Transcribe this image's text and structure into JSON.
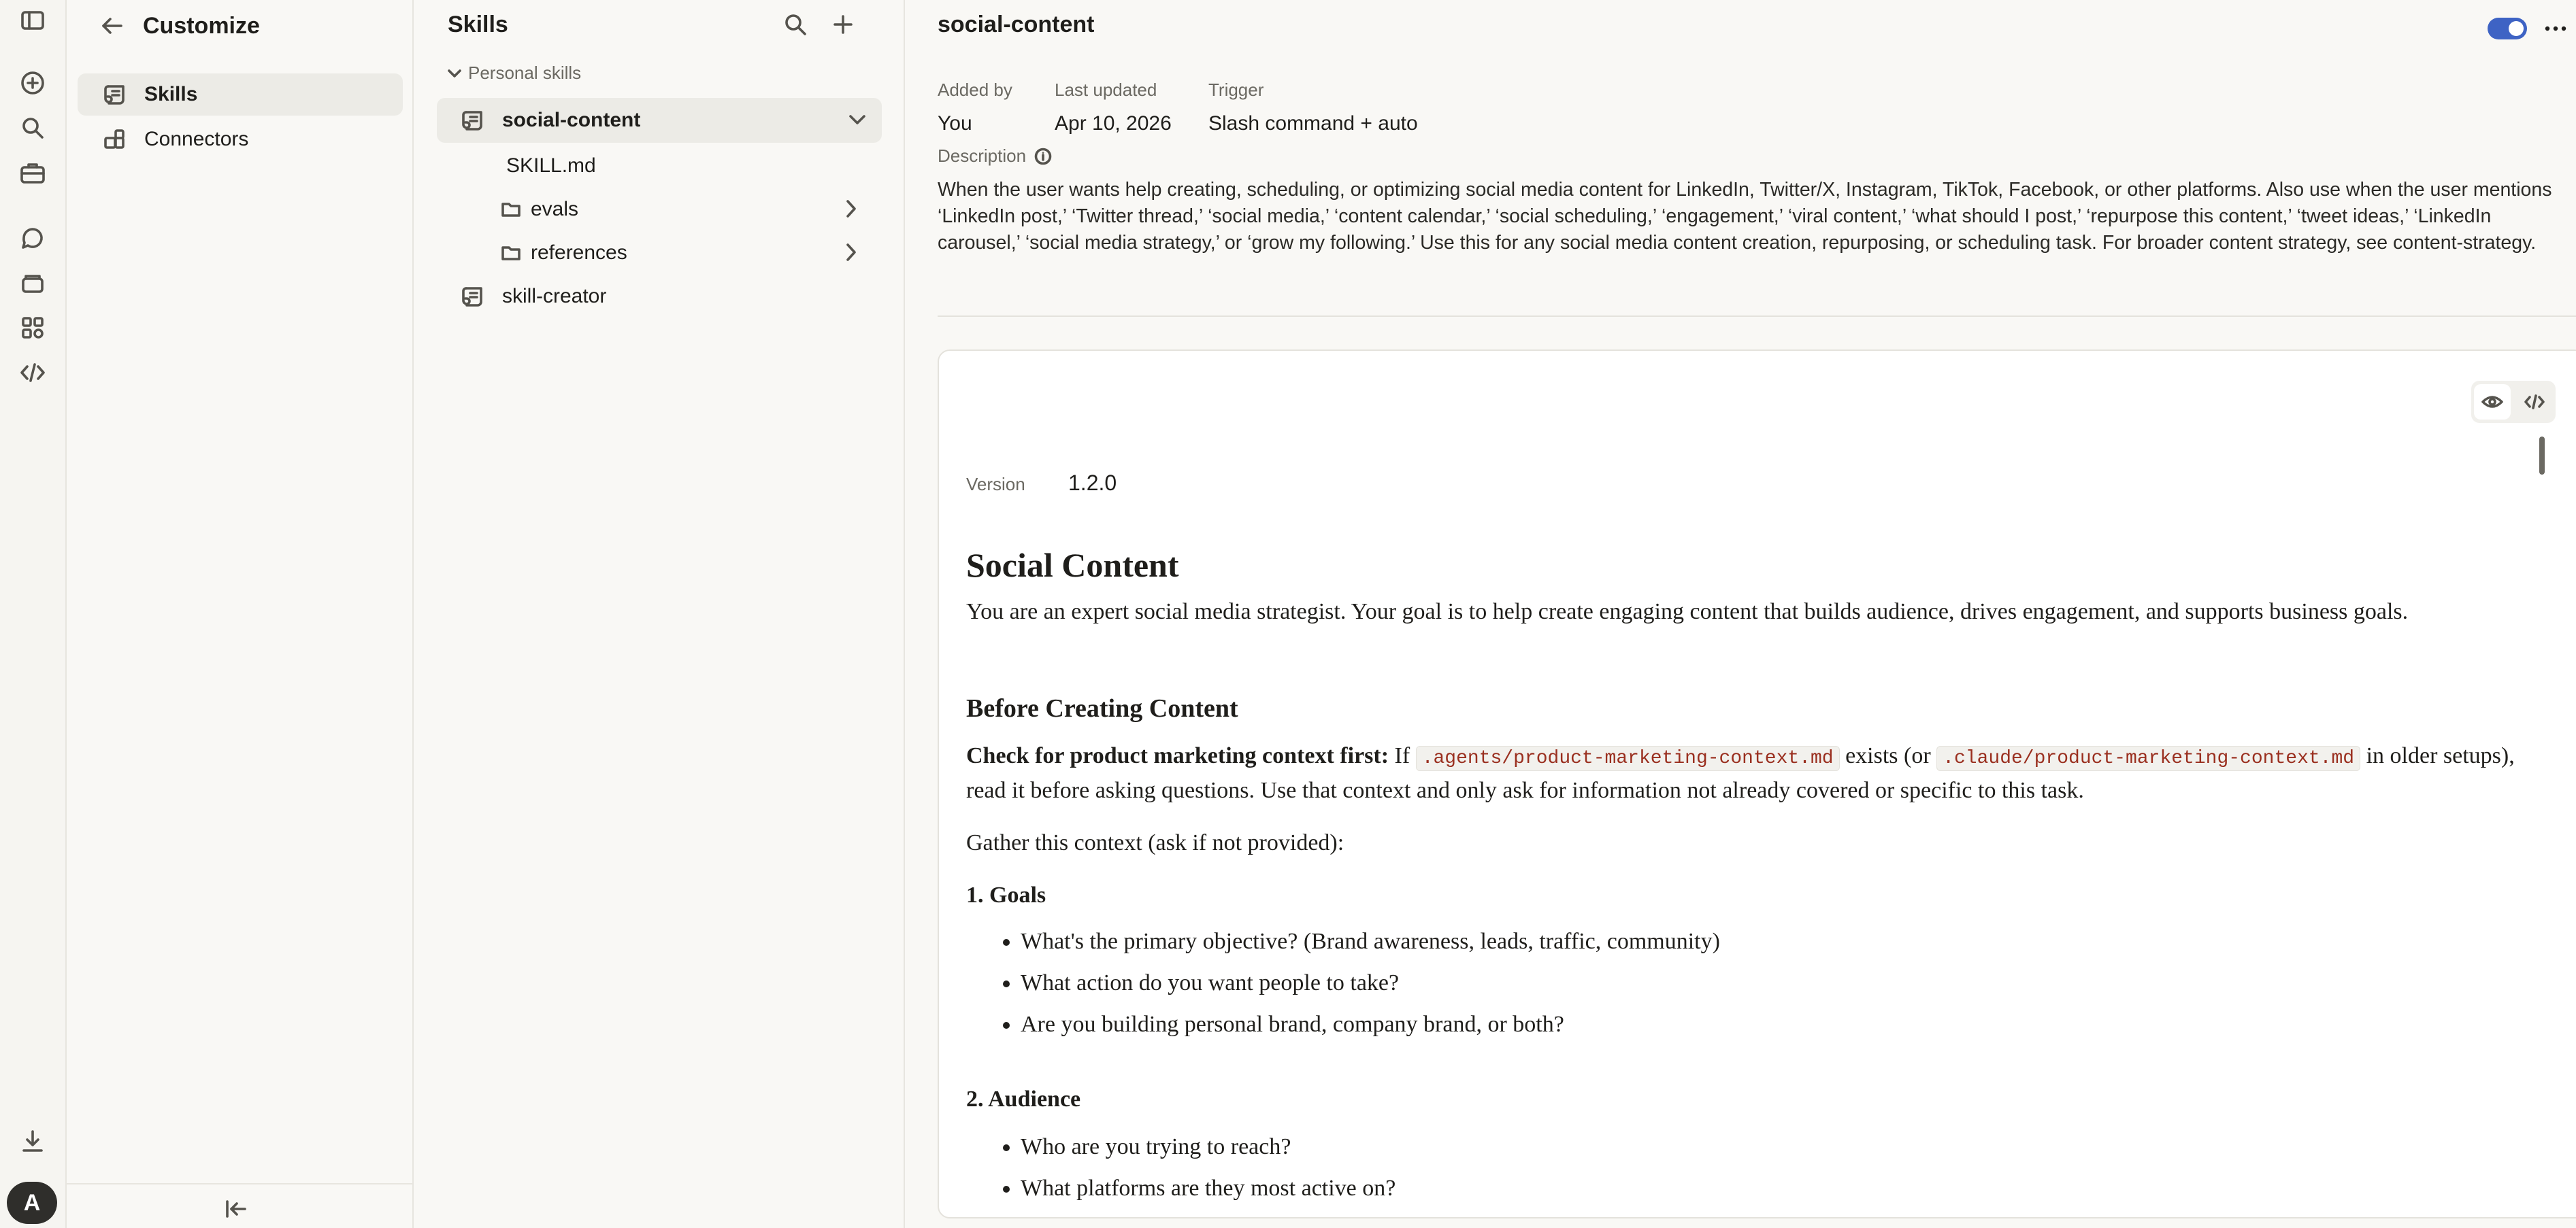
{
  "customize": {
    "title": "Customize",
    "nav": [
      {
        "label": "Skills",
        "icon": "skills-scroll-icon",
        "selected": true
      },
      {
        "label": "Connectors",
        "icon": "connectors-icon",
        "selected": false
      }
    ]
  },
  "skills_panel": {
    "title": "Skills",
    "section_label": "Personal skills",
    "items": [
      {
        "label": "social-content",
        "expanded": true
      },
      {
        "label": "SKILL.md"
      },
      {
        "label": "evals"
      },
      {
        "label": "references"
      },
      {
        "label": "skill-creator"
      }
    ]
  },
  "main": {
    "title": "social-content",
    "enabled": true,
    "meta": {
      "added_by_label": "Added by",
      "added_by_value": "You",
      "updated_label": "Last updated",
      "updated_value": "Apr 10, 2026",
      "trigger_label": "Trigger",
      "trigger_value": "Slash command + auto"
    },
    "description_label": "Description",
    "description": "When the user wants help creating, scheduling, or optimizing social media content for LinkedIn, Twitter/X, Instagram, TikTok, Facebook, or other platforms. Also use when the user mentions ‘LinkedIn post,’ ‘Twitter thread,’ ‘social media,’ ‘content calendar,’ ‘social scheduling,’ ‘engagement,’ ‘viral content,’ ‘what should I post,’ ‘repurpose this content,’ ‘tweet ideas,’ ‘LinkedIn carousel,’ ‘social media strategy,’ or ‘grow my following.’ Use this for any social media content creation, repurposing, or scheduling task. For broader content strategy, see content-strategy."
  },
  "document": {
    "version_label": "Version",
    "version_value": "1.2.0",
    "h1": "Social Content",
    "p1": "You are an expert social media strategist. Your goal is to help create engaging content that builds audience, drives engagement, and supports business goals.",
    "h2": "Before Creating Content",
    "p2_bold": "Check for product marketing context first:",
    "p2_a": " If ",
    "p2_code1": ".agents/product-marketing-context.md",
    "p2_b": " exists (or ",
    "p2_code2": ".claude/product-marketing-context.md",
    "p2_c": " in older setups), read it before asking questions. Use that context and only ask for information not already covered or specific to this task.",
    "p3": "Gather this context (ask if not provided):",
    "h3a": "1. Goals",
    "goals": [
      "What's the primary objective? (Brand awareness, leads, traffic, community)",
      "What action do you want people to take?",
      "Are you building personal brand, company brand, or both?"
    ],
    "h3b": "2. Audience",
    "audience": [
      "Who are you trying to reach?",
      "What platforms are they most active on?"
    ]
  },
  "avatar_initial": "A",
  "colors": {
    "accent": "#3e63c4",
    "code_text": "#9a2f1f",
    "background": "#f9f8f5"
  }
}
